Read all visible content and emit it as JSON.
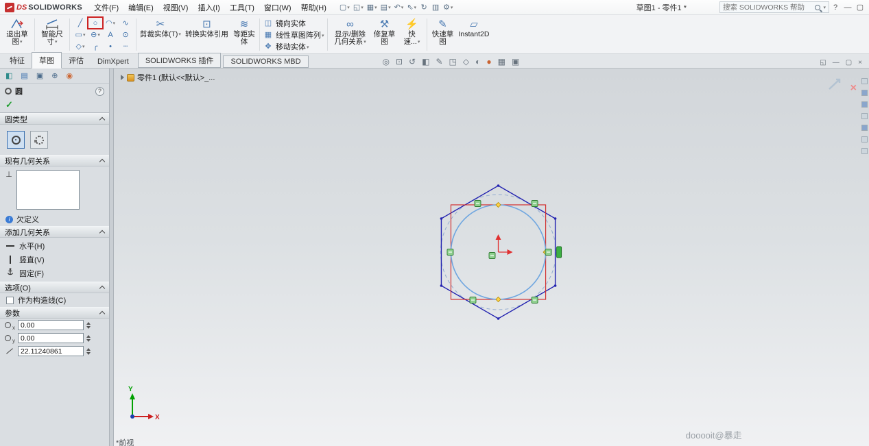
{
  "titlebar": {
    "brand_mark": "DS",
    "brand_name": "SOLIDWORKS",
    "menus": [
      "文件(F)",
      "编辑(E)",
      "视图(V)",
      "插入(I)",
      "工具(T)",
      "窗口(W)",
      "帮助(H)"
    ],
    "doc_title": "草图1 - 零件1 *",
    "search_placeholder": "搜索 SOLIDWORKS 帮助"
  },
  "icons": {
    "help": "?",
    "minimize": "—",
    "maximize": "▢",
    "close": "×"
  },
  "qat": [
    {
      "g": "▢"
    },
    {
      "g": "◱"
    },
    {
      "g": "▦"
    },
    {
      "g": "▤"
    },
    {
      "g": "↶"
    },
    {
      "g": "⇖"
    },
    {
      "g": "↻"
    },
    {
      "g": "▥"
    },
    {
      "g": "⚙"
    }
  ],
  "sketch_tools": [
    {
      "g": "╱"
    },
    {
      "g": "○"
    },
    {
      "g": "◠"
    },
    {
      "g": "∿"
    },
    {
      "g": "▭"
    },
    {
      "g": "⊖"
    },
    {
      "g": "A"
    },
    {
      "g": "⊙"
    },
    {
      "g": "◇"
    },
    {
      "g": "╭"
    },
    {
      "g": "•"
    },
    {
      "g": "┄"
    }
  ],
  "ribbon": {
    "exit_sketch": "退出草图",
    "smart_dimension": "智能尺寸",
    "trim": "剪裁实体(T)",
    "convert": "转换实体引用",
    "offset": "等距实体",
    "mirror": "镜向实体",
    "linear_pattern": "线性草图阵列",
    "move": "移动实体",
    "display_relations": "显示/删除几何关系",
    "repair": "修复草图",
    "quick_snaps": "快速...",
    "quick_sketch": "快速草图",
    "instant2d": "Instant2D"
  },
  "tabs": [
    {
      "label": "特征"
    },
    {
      "label": "草图"
    },
    {
      "label": "评估"
    },
    {
      "label": "DimXpert"
    },
    {
      "label": "SOLIDWORKS 插件"
    },
    {
      "label": "SOLIDWORKS MBD"
    }
  ],
  "hud": [
    {
      "g": "◎"
    },
    {
      "g": "⊡"
    },
    {
      "g": "↺"
    },
    {
      "g": "◧"
    },
    {
      "g": "✎"
    },
    {
      "g": "◳"
    },
    {
      "g": "◇"
    },
    {
      "g": "◐"
    },
    {
      "g": "●"
    },
    {
      "g": "▦"
    },
    {
      "g": "▣"
    }
  ],
  "winctl": [
    {
      "g": "◱"
    },
    {
      "g": "—"
    },
    {
      "g": "▢"
    },
    {
      "g": "×"
    }
  ],
  "mgr": [
    {
      "g": "◧"
    },
    {
      "g": "▤"
    },
    {
      "g": "▣"
    },
    {
      "g": "⊕"
    },
    {
      "g": "◉"
    }
  ],
  "tree": {
    "root_label": "零件1 (默认<<默认>_..."
  },
  "panel": {
    "title": "圆",
    "ok_glyph": "✓",
    "sections": {
      "type": "圆类型",
      "relations": "现有几何关系",
      "add_relations": "添加几何关系",
      "options": "选项(O)",
      "parameters": "参数"
    },
    "relation_list_icon": "⊥",
    "status": "欠定义",
    "relations": [
      {
        "label": "水平(H)"
      },
      {
        "label": "竖直(V)"
      },
      {
        "label": "固定(F)"
      }
    ],
    "construction_label": "作为构造线(C)",
    "params": [
      {
        "sub": "x",
        "value": "0.00"
      },
      {
        "sub": "y",
        "value": "0.00"
      },
      {
        "sub": "",
        "value": "22.11240861"
      }
    ]
  },
  "viewport": {
    "watermark": "dooooit@暴走",
    "view_label": "*前视",
    "axis_x": "X",
    "axis_y": "Y"
  }
}
